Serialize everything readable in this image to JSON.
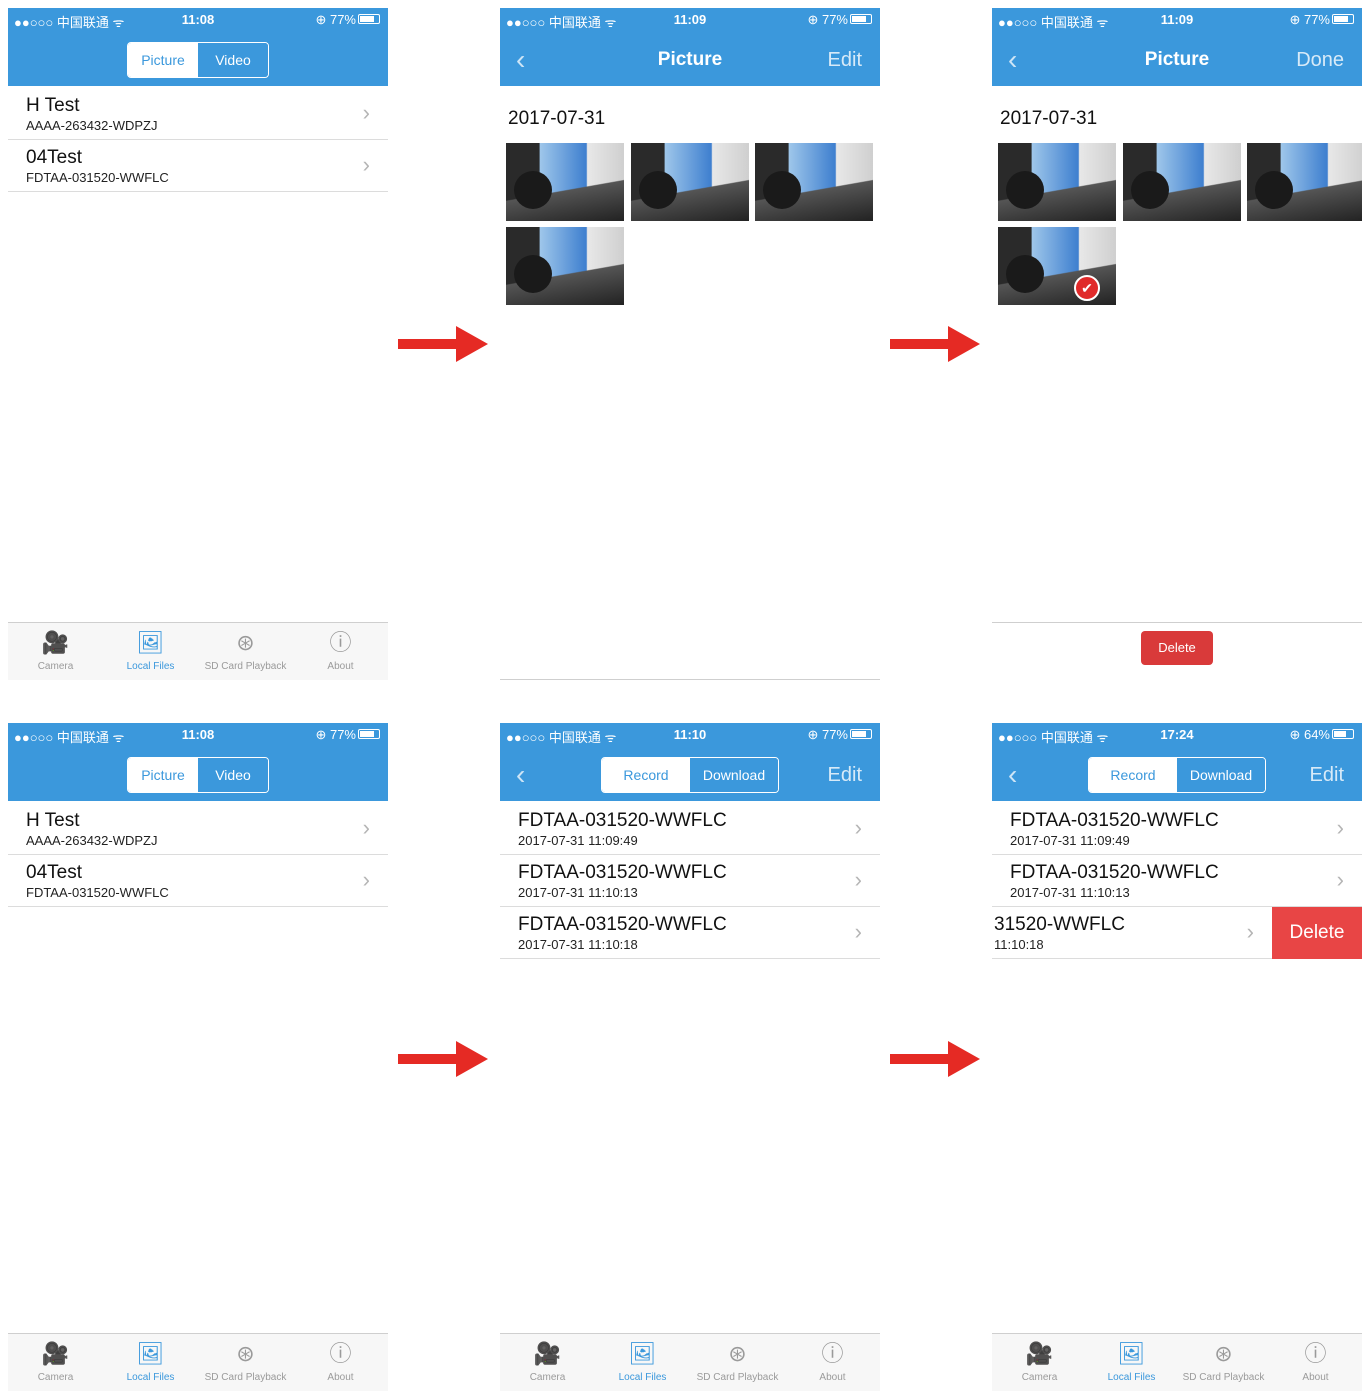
{
  "status": {
    "carrier": "●●○○○ 中国联通 ᯤ",
    "battery_77": "⊕ 77%",
    "battery_64": "⊕ 64%"
  },
  "screens": {
    "s1": {
      "time": "11:08"
    },
    "s2": {
      "time": "11:09",
      "title": "Picture",
      "right": "Edit",
      "date": "2017-07-31"
    },
    "s3": {
      "time": "11:09",
      "title": "Picture",
      "right": "Done",
      "date": "2017-07-31",
      "delete_label": "Delete"
    },
    "s4": {
      "time": "11:08"
    },
    "s5": {
      "time": "11:10",
      "right": "Edit"
    },
    "s6": {
      "time": "17:24",
      "right": "Edit",
      "swipe_delete": "Delete",
      "partial_title": "31520-WWFLC",
      "partial_sub": "11:10:18"
    }
  },
  "segments": {
    "picture": "Picture",
    "video": "Video",
    "record": "Record",
    "download": "Download"
  },
  "devices": [
    {
      "name": "H Test",
      "uid": "AAAA-263432-WDPZJ"
    },
    {
      "name": "04Test",
      "uid": "FDTAA-031520-WWFLC"
    }
  ],
  "records": [
    {
      "name": "FDTAA-031520-WWFLC",
      "time": "2017-07-31 11:09:49"
    },
    {
      "name": "FDTAA-031520-WWFLC",
      "time": "2017-07-31 11:10:13"
    },
    {
      "name": "FDTAA-031520-WWFLC",
      "time": "2017-07-31 11:10:18"
    }
  ],
  "tabs": [
    {
      "label": "Camera",
      "icon": "camera-icon"
    },
    {
      "label": "Local Files",
      "icon": "local-files-icon"
    },
    {
      "label": "SD Card Playback",
      "icon": "sd-card-icon"
    },
    {
      "label": "About",
      "icon": "about-icon"
    }
  ],
  "glyphs": {
    "chevron": "›",
    "back": "‹",
    "check": "✔"
  },
  "colors": {
    "nav_blue": "#3b98dc",
    "delete_red": "#e84545",
    "arrow_red": "#e52a24"
  }
}
